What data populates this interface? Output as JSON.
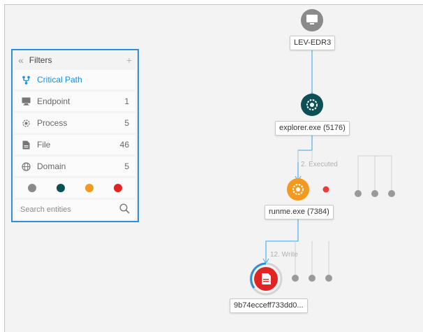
{
  "graph": {
    "nodes": [
      {
        "id": "endpoint",
        "label": "LEV-EDR3",
        "icon": "monitor-icon",
        "color": "#8a8a8a"
      },
      {
        "id": "explorer",
        "label": "explorer.exe (5176)",
        "icon": "process-icon",
        "color": "#0c4f55"
      },
      {
        "id": "runme",
        "label": "runme.exe (7384)",
        "icon": "process-icon",
        "color": "#f39a1e"
      },
      {
        "id": "file",
        "label": "9b74ecceff733dd0...",
        "icon": "file-icon",
        "color": "#e02424"
      }
    ],
    "edge_labels": [
      "2. Executed",
      "12. Write"
    ]
  },
  "filters": {
    "title": "Filters",
    "items": [
      {
        "label": "Critical Path",
        "count": "",
        "icon": "critical-path-icon",
        "active": true
      },
      {
        "label": "Endpoint",
        "count": "1",
        "icon": "monitor-icon"
      },
      {
        "label": "Process",
        "count": "5",
        "icon": "process-icon"
      },
      {
        "label": "File",
        "count": "46",
        "icon": "file-icon"
      },
      {
        "label": "Domain",
        "count": "5",
        "icon": "globe-icon"
      }
    ],
    "colors": [
      "#8a8a8a",
      "#0c4f55",
      "#f39a1e",
      "#e02424"
    ],
    "search_placeholder": "Search entities"
  },
  "colors": {
    "accent": "#2e8fd8",
    "edge": "#5ab4ec",
    "stub": "#9a9a9a"
  }
}
